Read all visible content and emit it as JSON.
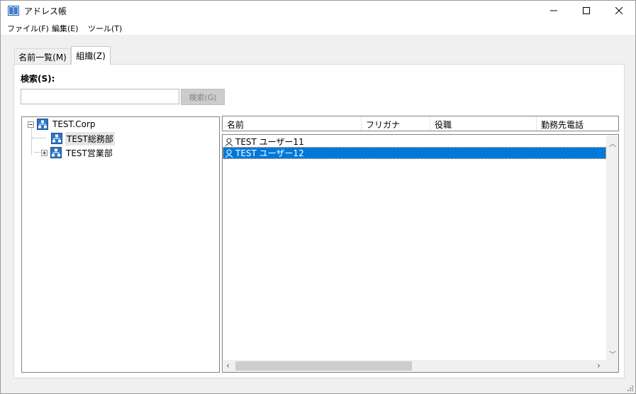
{
  "window": {
    "title": "アドレス帳",
    "icon": "address-book-icon"
  },
  "menu": {
    "items": [
      "ファイル(F)",
      "編集(E)",
      "ツール(T)"
    ]
  },
  "tabs": [
    {
      "label": "名前一覧(M)",
      "active": false
    },
    {
      "label": "組織(Z)",
      "active": true
    }
  ],
  "search": {
    "label": "検索(S):",
    "value": "",
    "placeholder": "",
    "button_label": "検索(G)"
  },
  "tree": {
    "nodes": [
      {
        "label": "TEST.Corp",
        "expanded": true,
        "selected": false
      },
      {
        "label": "TEST総務部",
        "expanded": null,
        "selected": true
      },
      {
        "label": "TEST営業部",
        "expanded": false,
        "selected": false
      }
    ]
  },
  "list": {
    "columns": [
      "名前",
      "フリガナ",
      "役職",
      "勤務先電話"
    ],
    "rows": [
      {
        "name": "TEST ユーザー11",
        "selected": false
      },
      {
        "name": "TEST ユーザー12",
        "selected": true
      }
    ]
  },
  "colors": {
    "selection": "#0078d7",
    "window_bg": "#f0f0f0"
  }
}
